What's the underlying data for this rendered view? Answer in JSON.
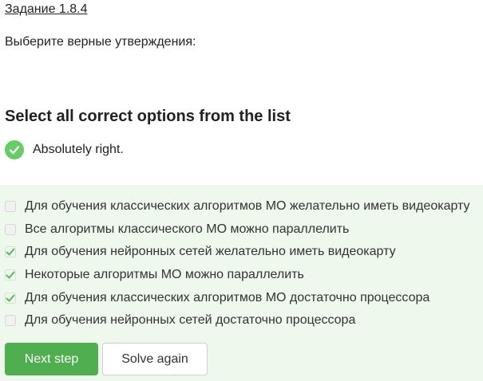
{
  "lesson_link": "Задание 1.8.4",
  "prompt": "Выберите верные утверждения:",
  "heading": "Select all correct options from the list",
  "status": {
    "text": "Absolutely right.",
    "icon": "check-circle-icon",
    "color": "#66cc66"
  },
  "options": [
    {
      "label": "Для обучения классических алгоритмов МО желательно иметь видеокарту",
      "checked": false
    },
    {
      "label": "Все алгоритмы классического МО можно параллелить",
      "checked": false
    },
    {
      "label": "Для обучения нейронных сетей желательно иметь видеокарту",
      "checked": true
    },
    {
      "label": "Некоторые алгоритмы МО можно параллелить",
      "checked": true
    },
    {
      "label": "Для обучения классических алгоритмов МО достаточно процессора",
      "checked": true
    },
    {
      "label": "Для обучения нейронных сетей достаточно процессора",
      "checked": false
    }
  ],
  "buttons": {
    "next": "Next step",
    "solve_again": "Solve again"
  },
  "colors": {
    "accent": "#4fae4e",
    "options_background": "#eef8ed",
    "check": "#5cb85c"
  }
}
